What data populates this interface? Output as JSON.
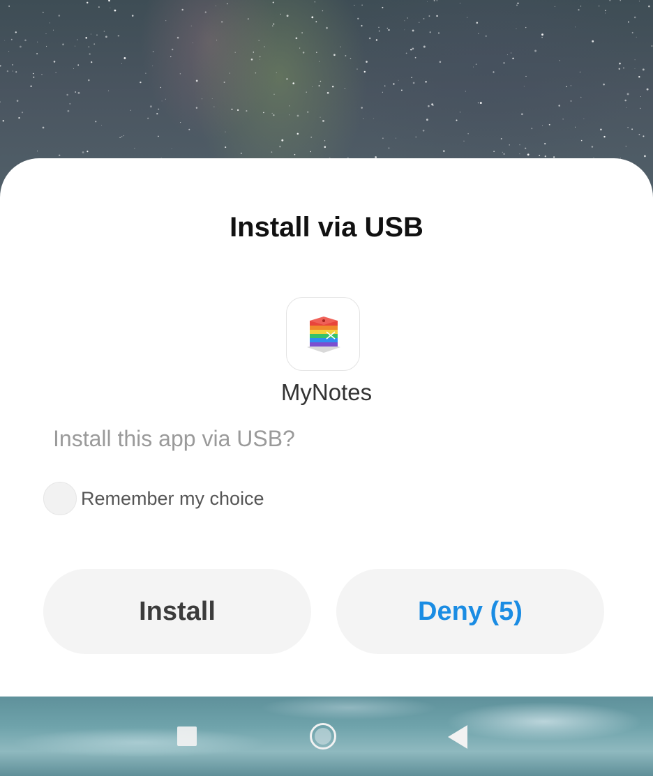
{
  "dialog": {
    "title": "Install via USB",
    "app_name": "MyNotes",
    "question": "Install this app via USB?",
    "remember_label": "Remember my choice",
    "remember_checked": false
  },
  "buttons": {
    "install_label": "Install",
    "deny_label": "Deny (5)"
  },
  "icons": {
    "app": "rainbow-layers-app-icon",
    "nav_recent": "square-recents-icon",
    "nav_home": "circle-home-icon",
    "nav_back": "triangle-back-icon"
  },
  "colors": {
    "accent": "#1a8ce3",
    "sheet_background": "#ffffff",
    "button_background": "#f4f4f4"
  }
}
